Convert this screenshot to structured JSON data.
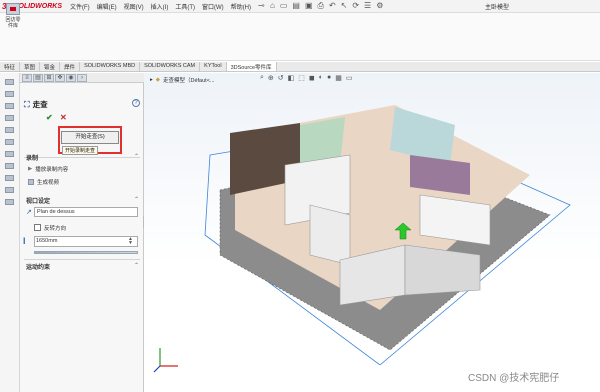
{
  "app": {
    "logo_ds": "3S",
    "logo_text": "SOLIDWORKS",
    "document_title": "主卧模型"
  },
  "menu": [
    "文件(F)",
    "编辑(E)",
    "视图(V)",
    "插入(I)",
    "工具(T)",
    "窗口(W)",
    "帮助(H)"
  ],
  "ribbon": {
    "button_label_line1": "回访零",
    "button_label_line2": "件库"
  },
  "tabs": [
    "特征",
    "草图",
    "钣金",
    "焊件",
    "SOLIDWORKS MBD",
    "SOLIDWORKS CAM",
    "KYTool",
    "3DSource零件库"
  ],
  "active_tab_index": 7,
  "property_manager": {
    "title": "走查",
    "help": "?",
    "start_button": "开始走查(S)",
    "tooltip": "开始录制走查",
    "record_section": "录制",
    "play_label": "播放录制内容",
    "video_label": "生成视频",
    "view_section": "视口设定",
    "view_value": "Plan de dessus",
    "flip_label": "反转方向",
    "height_value": "1650mm",
    "motion_section": "运动约束"
  },
  "graphics": {
    "tree_label": "走查模型（Défaut<..."
  },
  "watermark": "CSDN @技术宪肥仔",
  "colors": {
    "accent_red": "#e03030",
    "brand_red": "#d0021b",
    "guide_blue": "#3d86d8"
  }
}
